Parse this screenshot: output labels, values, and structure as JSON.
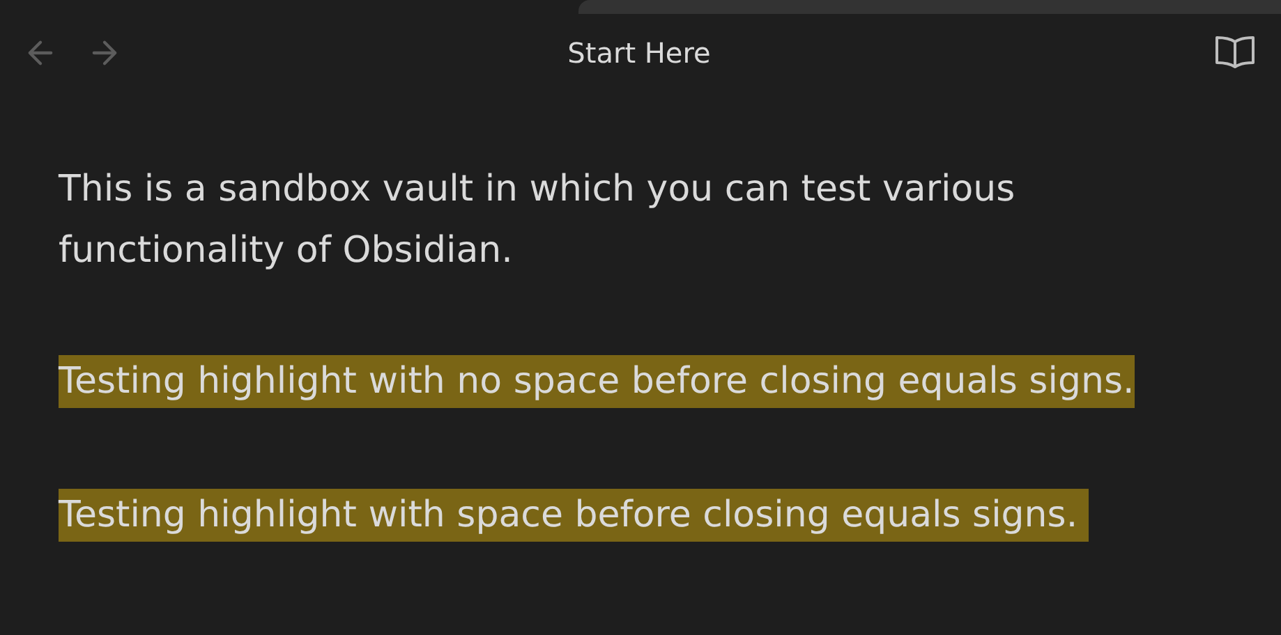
{
  "header": {
    "title": "Start Here"
  },
  "paragraphs": [
    {
      "kind": "text",
      "text": "This is a sandbox vault in which you can test various functionality of Obsidian."
    },
    {
      "kind": "highlight",
      "text": "Testing highlight with no space before closing equals signs."
    },
    {
      "kind": "highlight",
      "text": "Testing highlight with space before closing equals signs. "
    }
  ]
}
